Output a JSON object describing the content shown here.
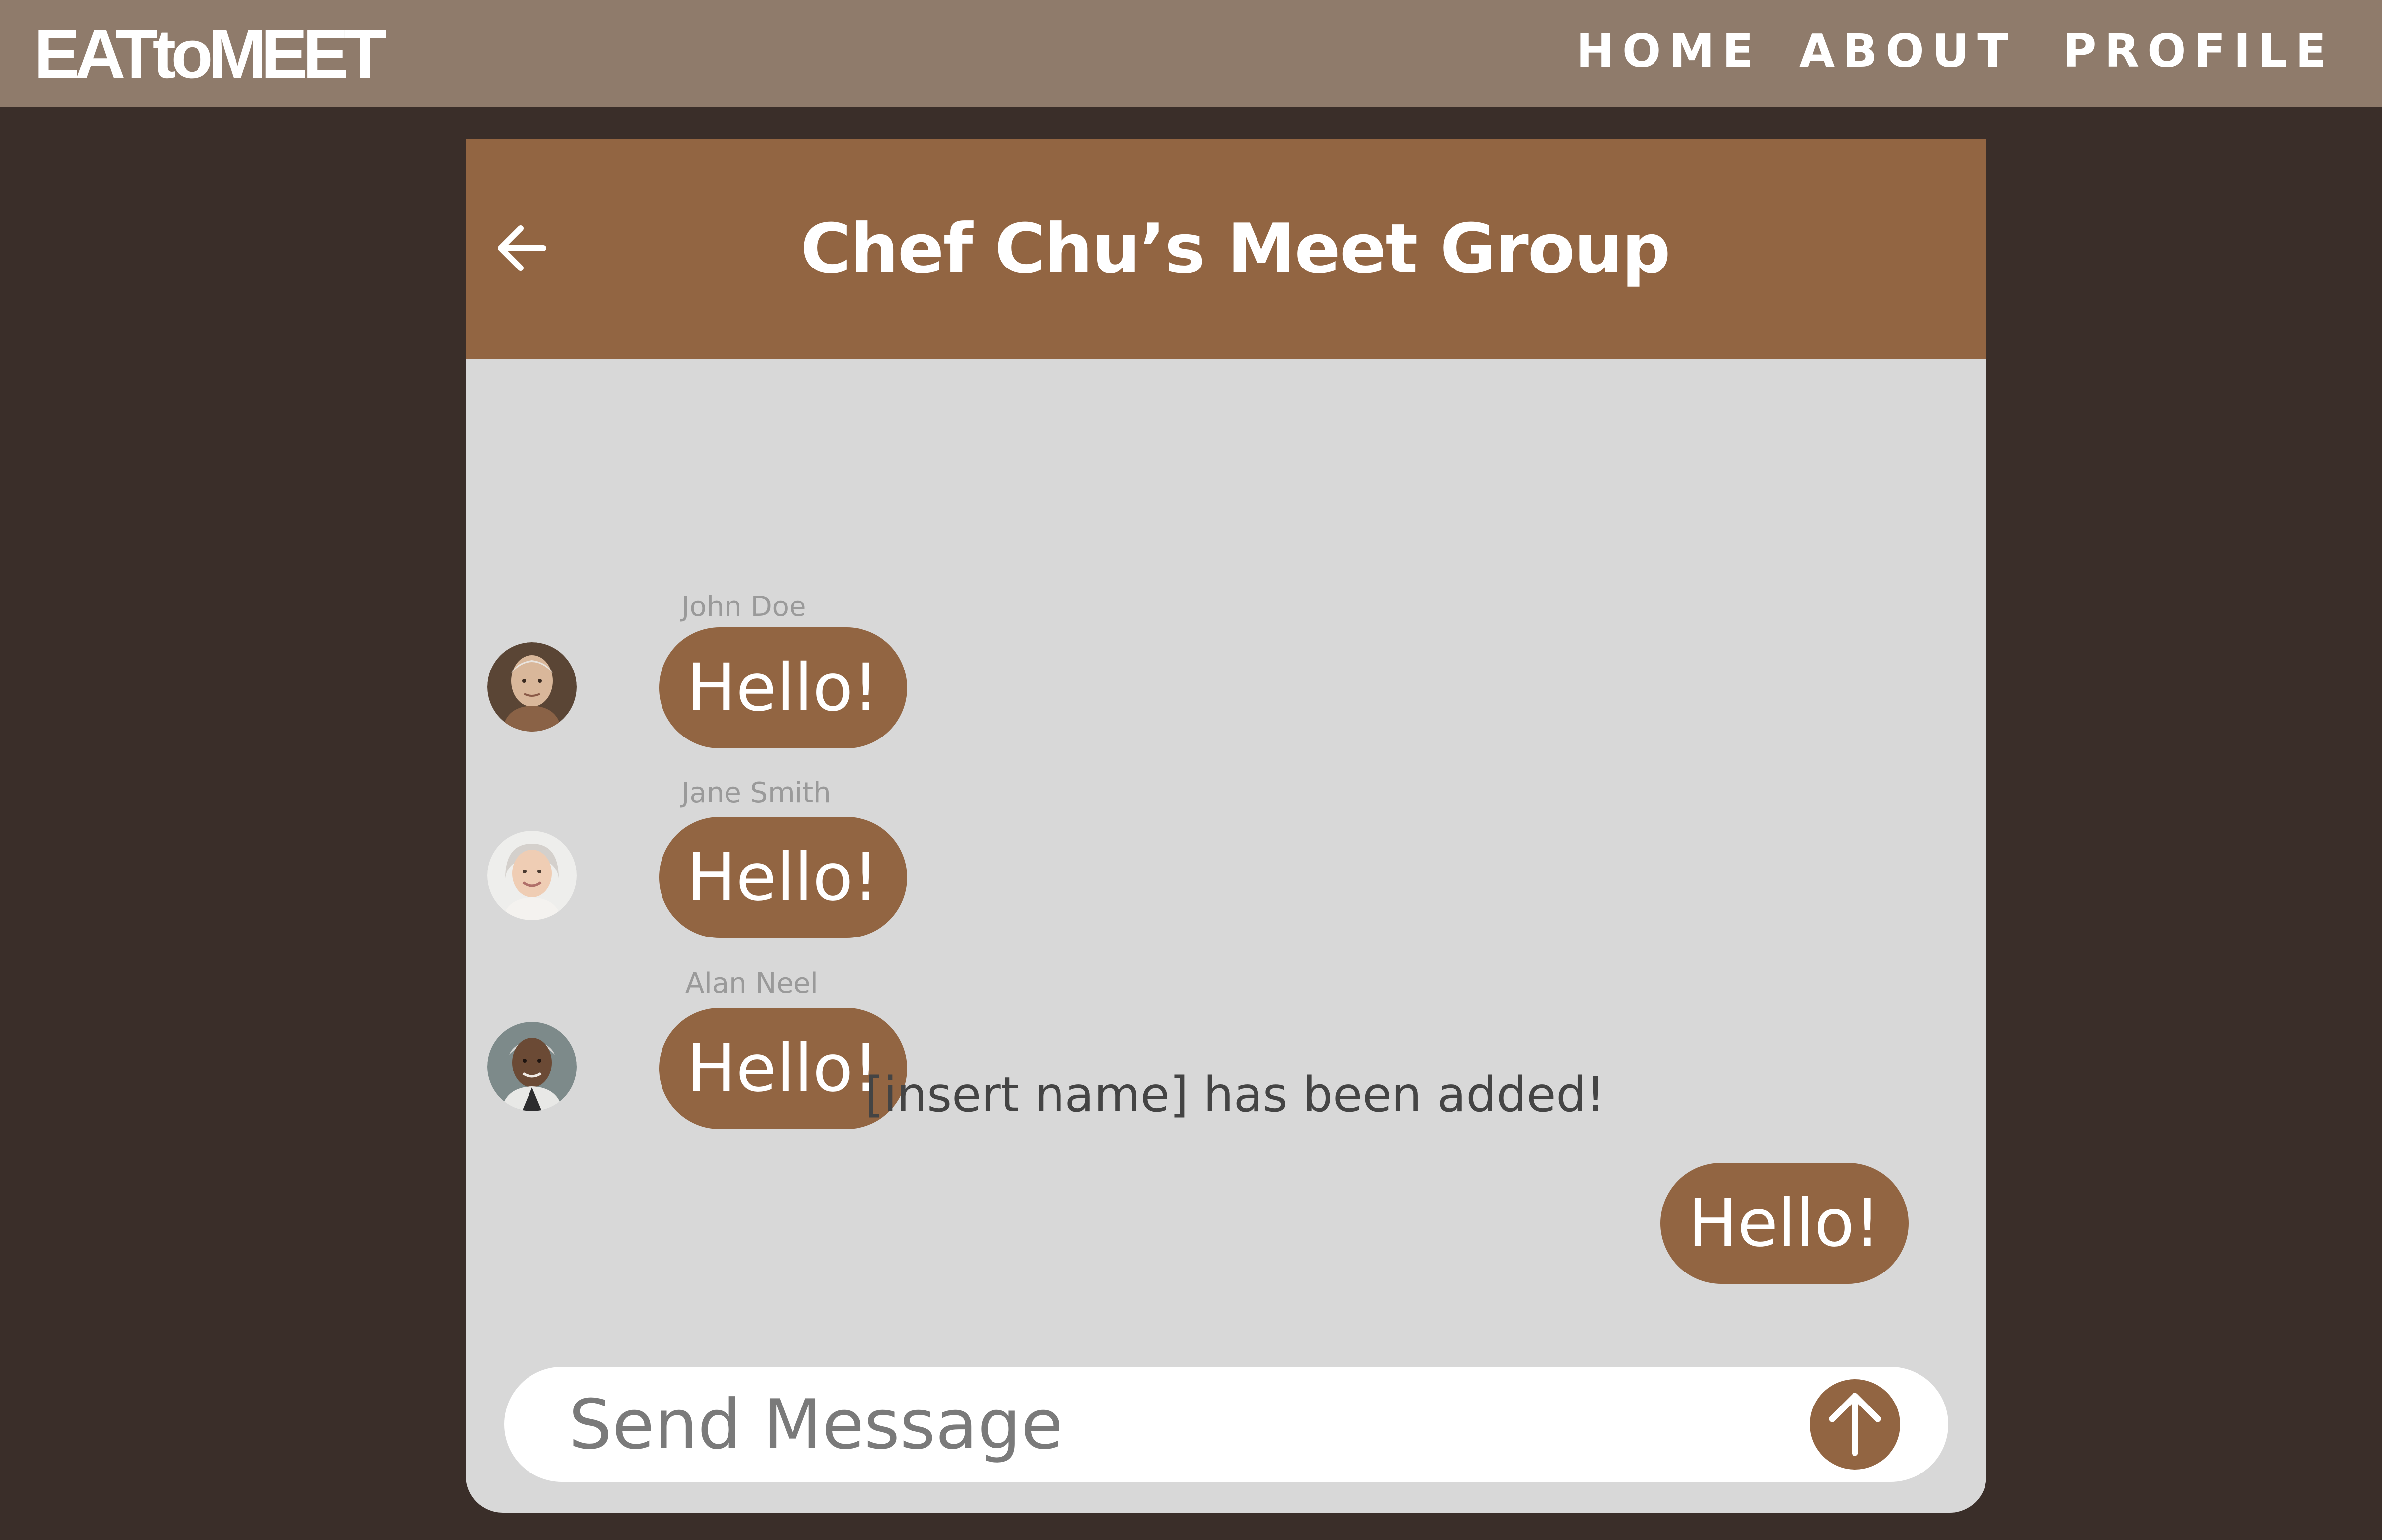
{
  "app": {
    "logo": "EATtoMEET"
  },
  "nav": {
    "home": "HOME",
    "about": "ABOUT",
    "profile": "PROFILE"
  },
  "chat": {
    "title": "Chef Chu’s Meet Group",
    "messages": [
      {
        "sender": "John Doe",
        "text": "Hello!"
      },
      {
        "sender": "Jane Smith",
        "text": "Hello!"
      },
      {
        "sender": "Alan Neel",
        "text": "Hello!"
      }
    ],
    "system_message": "[insert name] has been added!",
    "own_message": {
      "text": "Hello!"
    },
    "input": {
      "placeholder": "Send Message",
      "value": ""
    }
  },
  "icons": {
    "back": "arrow-left-icon",
    "send": "arrow-up-icon"
  },
  "colors": {
    "topbar": "#8f7b6b",
    "page_background": "#3a2e29",
    "accent": "#926542",
    "chat_background": "#d8d8d8",
    "sender_name": "#9a9a9a"
  }
}
